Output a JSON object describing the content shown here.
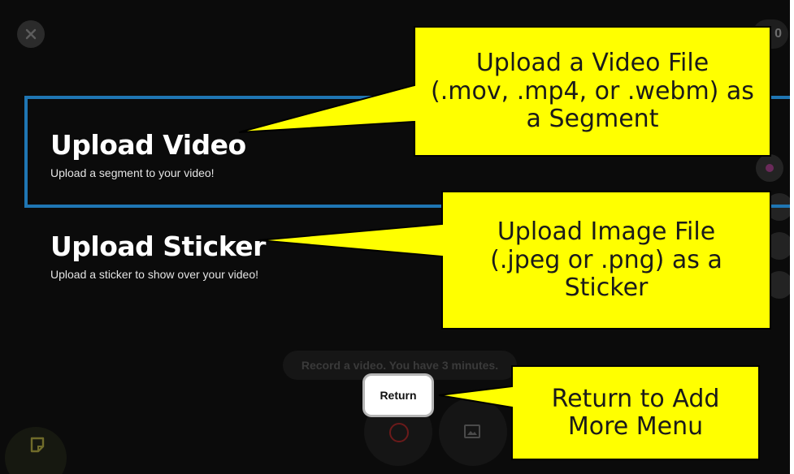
{
  "timer": {
    "value": "0"
  },
  "options": {
    "video": {
      "title": "Upload Video",
      "subtitle": "Upload a segment to your video!"
    },
    "sticker": {
      "title": "Upload Sticker",
      "subtitle": "Upload a sticker to show over your video!"
    }
  },
  "record_hint": "Record a video. You have 3 minutes.",
  "return_label": "Return",
  "callouts": {
    "video": {
      "lines": [
        "Upload a Video File",
        "(.mov, .mp4, or .webm) as",
        "a Segment"
      ]
    },
    "sticker": {
      "lines": [
        "Upload Image File",
        "(.jpeg or .png) as a",
        "Sticker"
      ]
    },
    "return": {
      "lines": [
        "Return to Add",
        "More Menu"
      ]
    }
  },
  "icons": {
    "close": "close-icon",
    "sticker": "sticker-icon",
    "image": "image-icon",
    "record": "record-icon"
  },
  "colors": {
    "background": "#0b0b0b",
    "selection_border": "#1f76b3",
    "callout_fill": "#ffff00",
    "callout_border": "#000000"
  }
}
